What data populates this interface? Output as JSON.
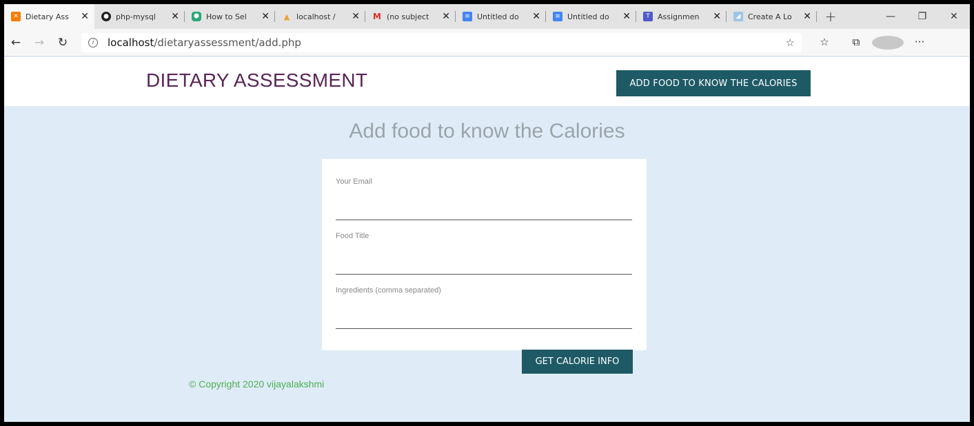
{
  "browser": {
    "tabs": [
      {
        "title": "Dietary Ass",
        "icon": "xampp-icon",
        "color": "#f57c00",
        "active": true
      },
      {
        "title": "php-mysql",
        "icon": "github-icon",
        "color": "#222222",
        "active": false
      },
      {
        "title": "How to Sel",
        "icon": "hexagon-icon",
        "color": "#2aa876",
        "active": false
      },
      {
        "title": "localhost /",
        "icon": "phpmyadmin-icon",
        "color": "#f0a030",
        "active": false
      },
      {
        "title": "(no subject",
        "icon": "gmail-icon",
        "color": "#d93025",
        "active": false
      },
      {
        "title": "Untitled do",
        "icon": "docs-icon",
        "color": "#4285f4",
        "active": false
      },
      {
        "title": "Untitled do",
        "icon": "docs-icon",
        "color": "#4285f4",
        "active": false
      },
      {
        "title": "Assignmen",
        "icon": "teams-icon",
        "color": "#5059c9",
        "active": false
      },
      {
        "title": "Create A Lo",
        "icon": "page-icon",
        "color": "#9ec5e8",
        "active": false
      }
    ],
    "url_host": "localhost",
    "url_path": "/dietaryassessment/add.php"
  },
  "header": {
    "brand": "DIETARY ASSESSMENT",
    "nav_button": "ADD FOOD TO KNOW THE CALORIES"
  },
  "form": {
    "title": "Add food to know the Calories",
    "fields": [
      {
        "label": "Your Email",
        "value": ""
      },
      {
        "label": "Food Title",
        "value": ""
      },
      {
        "label": "Ingredients (comma separated)",
        "value": ""
      }
    ],
    "submit_label": "GET CALORIE INFO"
  },
  "footer": {
    "copyright": "© Copyright 2020 vijayalakshmi"
  },
  "colors": {
    "brand": "#5a2456",
    "button": "#1e5a66",
    "page_bg": "#dfecf7",
    "footer_text": "#4caf50"
  }
}
